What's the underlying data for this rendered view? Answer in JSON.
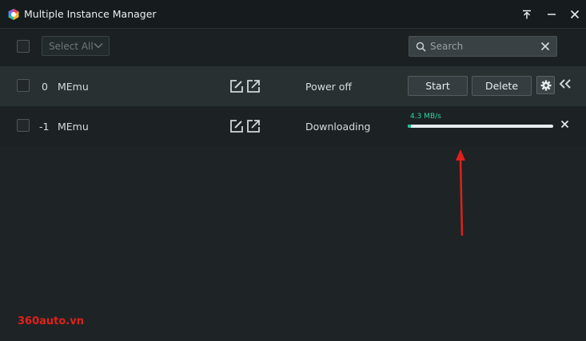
{
  "window": {
    "title": "Multiple Instance Manager"
  },
  "toolbar": {
    "select_all_label": "Select All",
    "search_placeholder": "Search"
  },
  "instances": [
    {
      "index": "0",
      "name": "MEmu",
      "status": "Power off",
      "start_label": "Start",
      "delete_label": "Delete"
    },
    {
      "index": "-1",
      "name": "MEmu",
      "status": "Downloading",
      "speed": "4.3 MB/s",
      "progress": 0.02
    }
  ],
  "watermark": "360auto.vn",
  "colors": {
    "accent": "#1fc59a",
    "background": "#1e2426",
    "annotation_arrow": "#e0201a"
  },
  "icons": [
    "app-logo-icon",
    "pin-icon",
    "close-icon",
    "chevron-down-icon",
    "search-icon",
    "clear-icon",
    "edit-icon",
    "shortcut-icon",
    "gear-icon",
    "collapse-icon",
    "cancel-icon"
  ]
}
